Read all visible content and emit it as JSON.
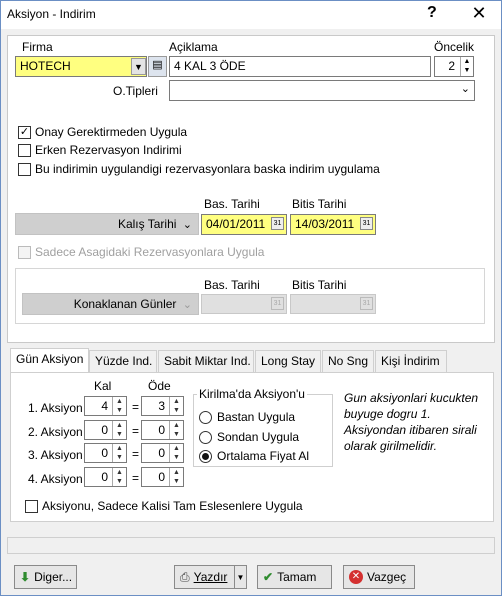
{
  "window": {
    "title": "Aksiyon - Indirim",
    "help_glyph": "?",
    "close_glyph": "✕"
  },
  "header": {
    "firma_label": "Firma",
    "firma_value": "HOTECH",
    "aciklama_label": "Açiklama",
    "aciklama_value": "4 KAL 3 ÖDE",
    "oncelik_label": "Öncelik",
    "oncelik_value": "2",
    "otipleri_label": "O.Tipleri",
    "otipleri_value": ""
  },
  "options": {
    "onay": {
      "label": "Onay Gerektirmeden Uygula",
      "checked": true
    },
    "erken": {
      "label": "Erken Rezervasyon Indirimi",
      "checked": false
    },
    "baska": {
      "label": "Bu indirimin uygulandigi rezervasyonlara baska indirim uygulama",
      "checked": false
    }
  },
  "dates": {
    "bas_label": "Bas. Tarihi",
    "bitis_label": "Bitis Tarihi",
    "kalis_label": "Kalış Tarihi",
    "bas_value": "04/01/2011",
    "bitis_value": "14/03/2011"
  },
  "sadece": {
    "label": "Sadece Asagidaki Rezervasyonlara Uygula",
    "checked": false,
    "enabled": false
  },
  "konaklanan": {
    "bas_label": "Bas. Tarihi",
    "bitis_label": "Bitis Tarihi",
    "label": "Konaklanan Günler"
  },
  "tabs": [
    {
      "label": "Gün Aksiyon",
      "active": true
    },
    {
      "label": "Yüzde Ind.",
      "active": false
    },
    {
      "label": "Sabit Miktar Ind.",
      "active": false
    },
    {
      "label": "Long Stay",
      "active": false
    },
    {
      "label": "No Sng",
      "active": false
    },
    {
      "label": "Kişi İndirim",
      "active": false
    }
  ],
  "gun_aksiyon": {
    "kal_header": "Kal",
    "ode_header": "Öde",
    "equals": "=",
    "rows": [
      {
        "label": "1. Aksiyon",
        "kal": "4",
        "ode": "3"
      },
      {
        "label": "2. Aksiyon",
        "kal": "0",
        "ode": "0"
      },
      {
        "label": "3. Aksiyon",
        "kal": "0",
        "ode": "0"
      },
      {
        "label": "4. Aksiyon",
        "kal": "0",
        "ode": "0"
      }
    ],
    "kirilma_title": "Kirilma'da Aksiyon'u",
    "radios": [
      {
        "label": "Bastan Uygula",
        "selected": false
      },
      {
        "label": "Sondan Uygula",
        "selected": false
      },
      {
        "label": "Ortalama Fiyat Al",
        "selected": true
      }
    ],
    "note": "Gun aksiyonlari kucukten buyuge dogru 1. Aksiyondan itibaren sirali olarak girilmelidir.",
    "tam_esles": {
      "label": "Aksiyonu, Sadece Kalisi Tam Eslesenlere Uygula",
      "checked": false
    }
  },
  "footer": {
    "diger": "Diger...",
    "yazdir": "Yazdır",
    "tamam": "Tamam",
    "vazgec": "Vazgeç"
  },
  "colors": {
    "yellow_field": "#ffff80",
    "border": "#6b8fc4"
  }
}
